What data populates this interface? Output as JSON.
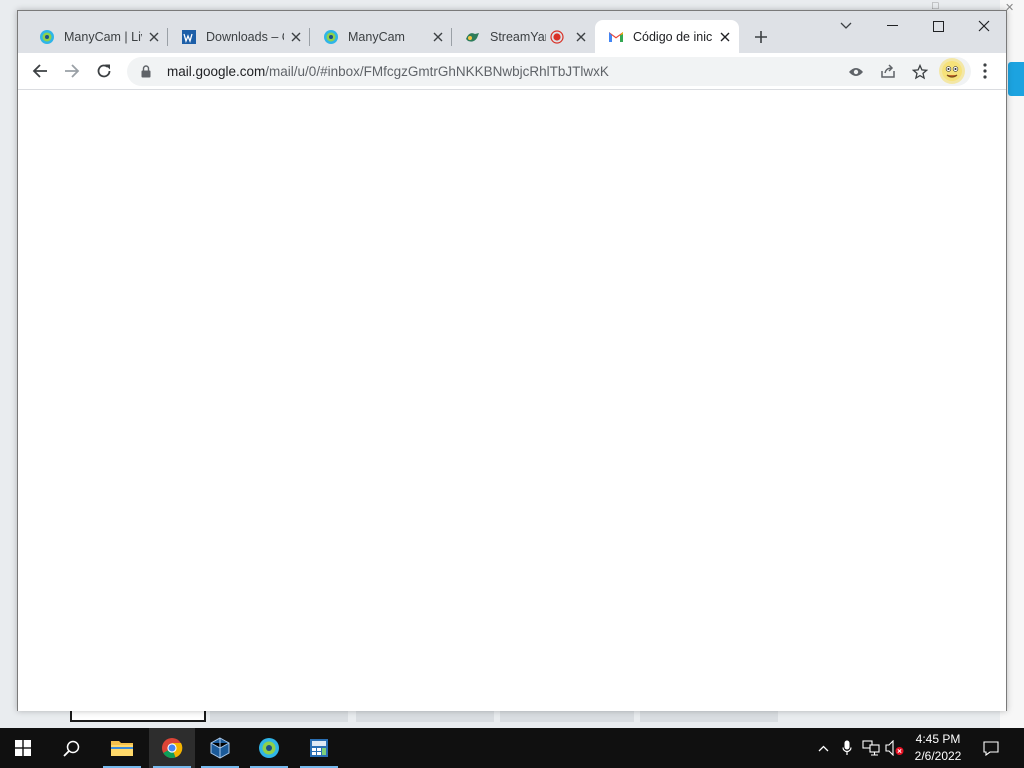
{
  "browser": {
    "tabs": [
      {
        "title": "ManyCam | Liv",
        "icon": "manycam-icon",
        "active": false
      },
      {
        "title": "Downloads – C",
        "icon": "downloads-icon",
        "active": false
      },
      {
        "title": "ManyCam",
        "icon": "manycam-icon",
        "active": false
      },
      {
        "title": "StreamYard",
        "icon": "streamyard-icon",
        "active": false,
        "recording": true
      },
      {
        "title": "Código de inic",
        "icon": "gmail-icon",
        "active": true
      }
    ],
    "url_host": "mail.google.com",
    "url_path": "/mail/u/0/#inbox/FMfcgzGmtrGhNKKBNwbjcRhlTbJTlwxK",
    "accent": "#1a73e8"
  },
  "taskbar": {
    "apps": [
      "start-button",
      "search-button",
      "file-explorer",
      "chrome",
      "virtualbox",
      "manycam",
      "app-6"
    ],
    "time": "4:45 PM",
    "date": "2/6/2022"
  }
}
